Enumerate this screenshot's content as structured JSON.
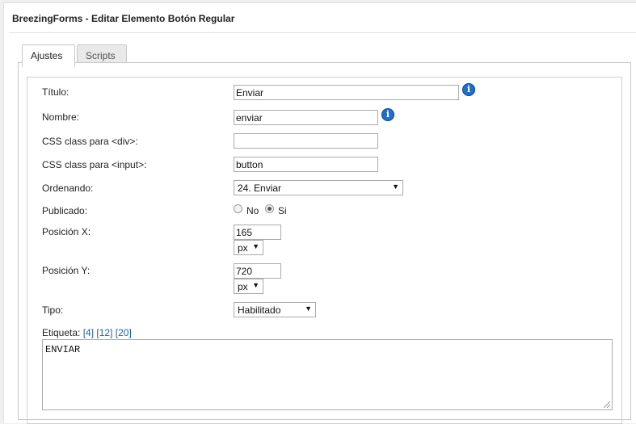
{
  "window": {
    "title": "BreezingForms - Editar Elemento Botón Regular"
  },
  "tabs": [
    {
      "label": "Ajustes",
      "active": true
    },
    {
      "label": "Scripts",
      "active": false
    }
  ],
  "form": {
    "titulo": {
      "label": "Título:",
      "value": "Enviar"
    },
    "nombre": {
      "label": "Nombre:",
      "value": "enviar"
    },
    "css_div": {
      "label": "CSS class para <div>:",
      "value": ""
    },
    "css_input": {
      "label": "CSS class para <input>:",
      "value": "button"
    },
    "ordenando": {
      "label": "Ordenando:",
      "selected": "24. Enviar"
    },
    "publicado": {
      "label": "Publicado:",
      "options": [
        "No",
        "Si"
      ],
      "selected": "Si"
    },
    "posicion_x": {
      "label": "Posición X:",
      "value": "165",
      "unit": "px"
    },
    "posicion_y": {
      "label": "Posición Y:",
      "value": "720",
      "unit": "px"
    },
    "tipo": {
      "label": "Tipo:",
      "selected": "Habilitado"
    },
    "etiqueta": {
      "label": "Etiqueta:",
      "links": [
        "[4]",
        "[12]",
        "[20]"
      ],
      "value": "ENVIAR"
    }
  },
  "icons": {
    "info": "info-icon",
    "dropdown": "chevron-down-icon"
  },
  "colors": {
    "info_blue": "#1f6fc9",
    "link_blue": "#1f5ea8"
  }
}
